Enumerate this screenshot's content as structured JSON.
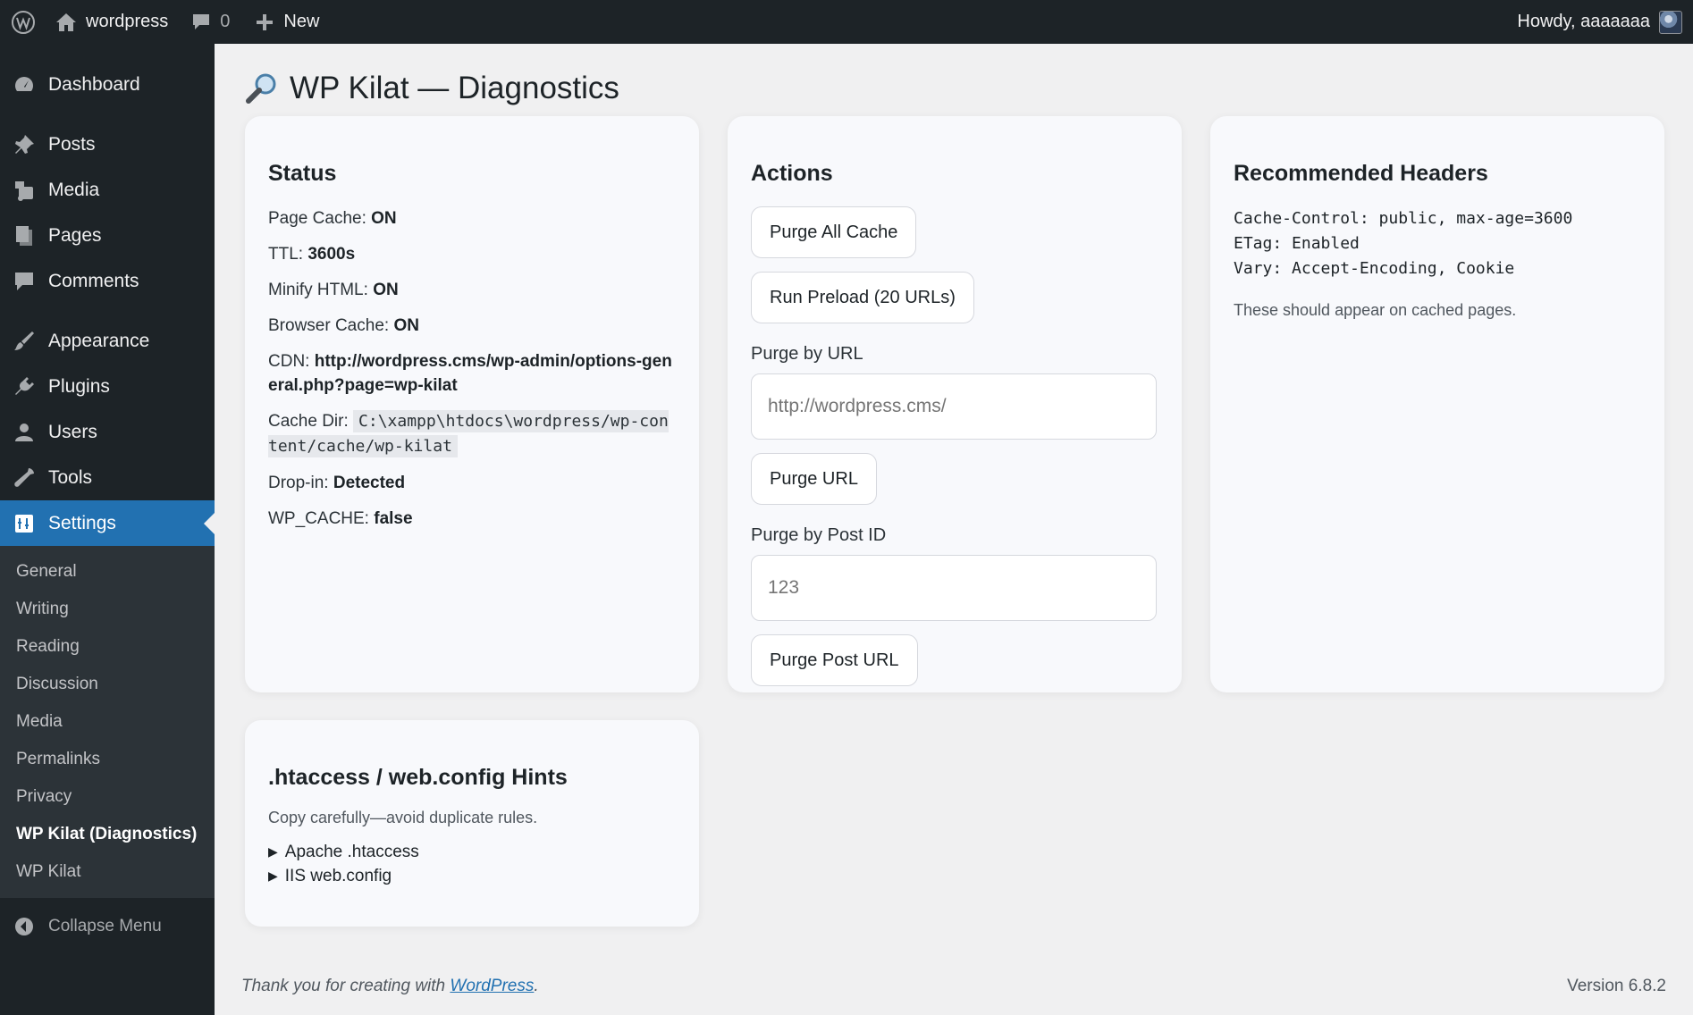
{
  "adminbar": {
    "site_name": "wordpress",
    "comments_count": "0",
    "new_label": "New",
    "howdy": "Howdy, aaaaaaa"
  },
  "sidebar": {
    "items": [
      {
        "label": "Dashboard",
        "icon": "dashboard-icon"
      },
      {
        "label": "Posts",
        "icon": "pin-icon"
      },
      {
        "label": "Media",
        "icon": "media-icon"
      },
      {
        "label": "Pages",
        "icon": "pages-icon"
      },
      {
        "label": "Comments",
        "icon": "comment-icon"
      },
      {
        "label": "Appearance",
        "icon": "brush-icon"
      },
      {
        "label": "Plugins",
        "icon": "plug-icon"
      },
      {
        "label": "Users",
        "icon": "user-icon"
      },
      {
        "label": "Tools",
        "icon": "wrench-icon"
      },
      {
        "label": "Settings",
        "icon": "settings-icon"
      }
    ],
    "submenu": [
      "General",
      "Writing",
      "Reading",
      "Discussion",
      "Media",
      "Permalinks",
      "Privacy",
      "WP Kilat (Diagnostics)",
      "WP Kilat"
    ],
    "collapse_label": "Collapse Menu"
  },
  "page": {
    "title": "WP Kilat — Diagnostics"
  },
  "status": {
    "heading": "Status",
    "page_cache_label": "Page Cache:",
    "page_cache_value": "ON",
    "ttl_label": "TTL:",
    "ttl_value": "3600s",
    "minify_label": "Minify HTML:",
    "minify_value": "ON",
    "browser_cache_label": "Browser Cache:",
    "browser_cache_value": "ON",
    "cdn_label": "CDN:",
    "cdn_value": "http://wordpress.cms/wp-admin/options-general.php?page=wp-kilat",
    "cache_dir_label": "Cache Dir:",
    "cache_dir_value": "C:\\xampp\\htdocs\\wordpress/wp-content/cache/wp-kilat",
    "dropin_label": "Drop-in:",
    "dropin_value": "Detected",
    "wp_cache_label": "WP_CACHE:",
    "wp_cache_value": "false"
  },
  "actions": {
    "heading": "Actions",
    "purge_all": "Purge All Cache",
    "run_preload": "Run Preload (20 URLs)",
    "purge_by_url_label": "Purge by URL",
    "purge_url_placeholder": "http://wordpress.cms/",
    "purge_url_button": "Purge URL",
    "purge_by_post_label": "Purge by Post ID",
    "purge_post_placeholder": "123",
    "purge_post_button": "Purge Post URL"
  },
  "headers": {
    "heading": "Recommended Headers",
    "lines": [
      "Cache-Control: public, max-age=3600",
      "ETag: Enabled",
      "Vary: Accept-Encoding, Cookie"
    ],
    "note": "These should appear on cached pages."
  },
  "hints": {
    "heading": ".htaccess / web.config Hints",
    "note": "Copy carefully—avoid duplicate rules.",
    "details": [
      "Apache .htaccess",
      "IIS web.config"
    ]
  },
  "footer": {
    "thanks_prefix": "Thank you for creating with",
    "thanks_link": "WordPress",
    "version": "Version 6.8.2"
  },
  "colors": {
    "accent": "#2271b1",
    "sidebar_bg": "#1d2327"
  }
}
